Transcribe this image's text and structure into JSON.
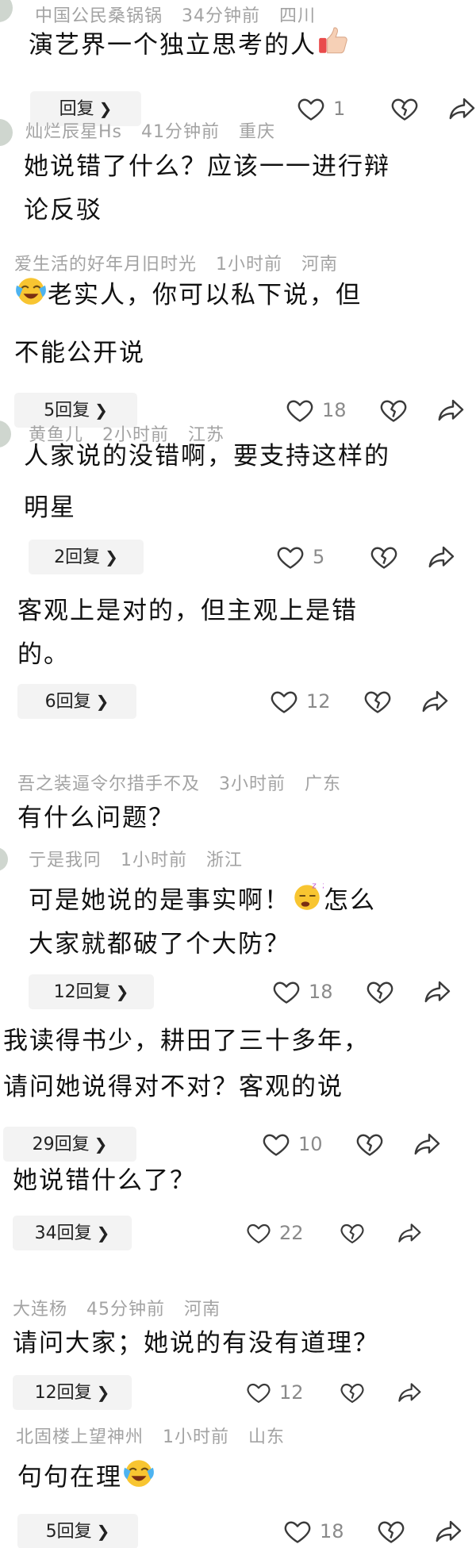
{
  "icons": {
    "like": "heart-outline-icon",
    "dislike": "broken-heart-icon",
    "share": "share-arrow-icon",
    "reply_chevron": "chevron-right-icon"
  },
  "comments": [
    {
      "user": "中国公民桑锅锅",
      "time": "34分钟前",
      "loc": "四川",
      "text1": "演艺界一个独立思考的人",
      "text2": "",
      "replies": "回复",
      "likes": "1",
      "emoji": "thumbs-up"
    },
    {
      "user": "灿烂辰星Hs",
      "time": "41分钟前",
      "loc": "重庆",
      "text1": "她说错了什么？应该一一进行辩",
      "text2": "论反驳",
      "replies": "",
      "likes": ""
    },
    {
      "user": "爱生活的好年月旧时光",
      "time": "1小时前",
      "loc": "河南",
      "text1": "老实人，你可以私下说，但",
      "text2": "不能公开说",
      "replies": "5回复",
      "likes": "18",
      "emoji": "crying-laughing"
    },
    {
      "user": "黄鱼儿",
      "time": "2小时前",
      "loc": "江苏",
      "text1": "人家说的没错啊，要支持这样的",
      "text2": "明星",
      "replies": "2回复",
      "likes": "5"
    },
    {
      "user": "",
      "time": "",
      "loc": "",
      "text1": "客观上是对的，但主观上是错",
      "text2": "的。",
      "replies": "6回复",
      "likes": "12"
    },
    {
      "user": "吾之装逼令尔措手不及",
      "time": "3小时前",
      "loc": "广东",
      "text1": "有什么问题？",
      "text2": "",
      "replies": "",
      "likes": ""
    },
    {
      "user": "亍是我冋",
      "time": "1小时前",
      "loc": "浙江",
      "text1": "可是她说的是事实啊！",
      "text1b": "怎么",
      "text2": "大家就都破了个大防？",
      "replies": "12回复",
      "likes": "18",
      "emoji": "sleepy-face"
    },
    {
      "user": "",
      "time": "",
      "loc": "",
      "text1": "我读得书少，耕田了三十多年，",
      "text2": "请问她说得对不对？客观的说",
      "replies": "29回复",
      "likes": "10"
    },
    {
      "user": "",
      "time": "",
      "loc": "",
      "text1": "她说错什么了？",
      "text2": "",
      "replies": "34回复",
      "likes": "22"
    },
    {
      "user": "大连杨",
      "time": "45分钟前",
      "loc": "河南",
      "text1": "请问大家；她说的有没有道理？",
      "text2": "",
      "replies": "12回复",
      "likes": "12"
    },
    {
      "user": "北固楼上望神州",
      "time": "1小时前",
      "loc": "山东",
      "text1": "句句在理",
      "text2": "",
      "replies": "5回复",
      "likes": "18",
      "emoji": "crying-laughing"
    }
  ]
}
